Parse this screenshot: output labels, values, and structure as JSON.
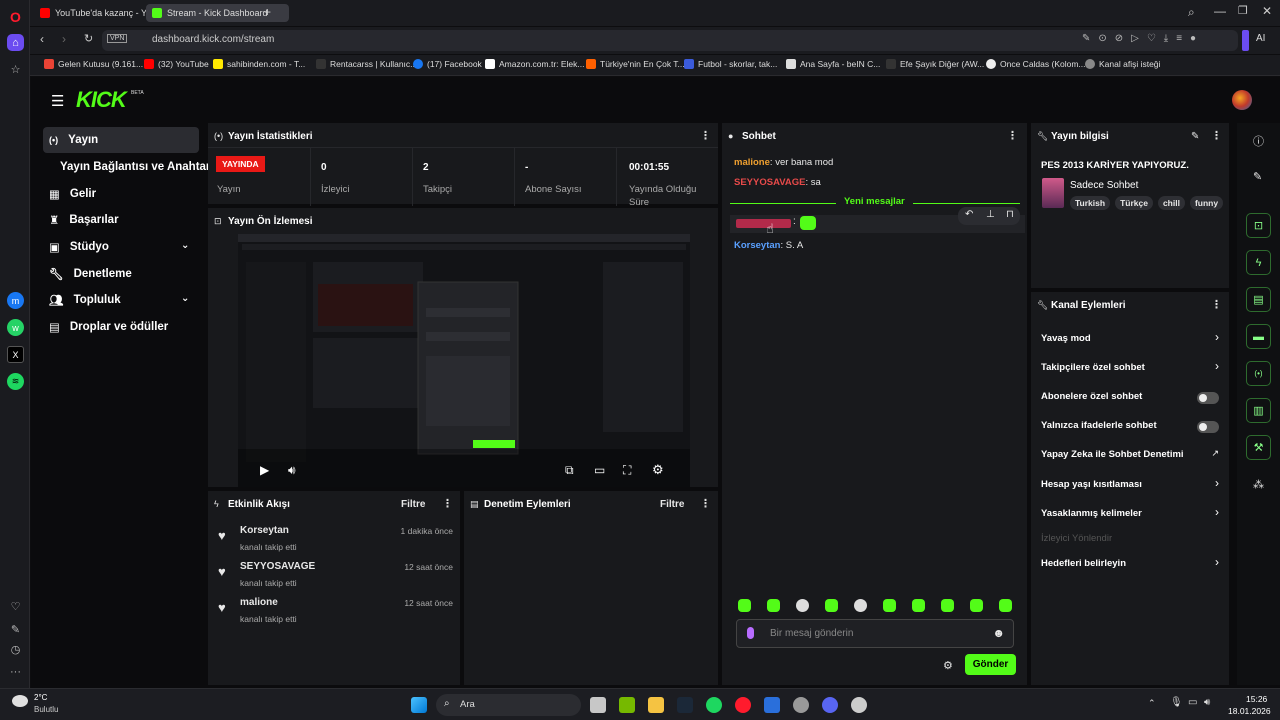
{
  "browser": {
    "tabs": [
      {
        "label": "YouTube'da kazanç - YouTu"
      },
      {
        "label": "Stream - Kick Dashboard"
      }
    ],
    "url": "dashboard.kick.com/stream",
    "vpn": "VPN",
    "ai": "AI",
    "bookmarks": [
      "Gelen Kutusu (9.161...",
      "(32) YouTube",
      "sahibinden.com - T...",
      "Rentacarss | Kullanıc...",
      "(17) Facebook",
      "Amazon.com.tr: Elek...",
      "Türkiye'nin En Çok T...",
      "Futbol - skorlar, tak...",
      "Ana Sayfa - beIN C...",
      "Efe Şayık Diğer (AW...",
      "Once Caldas (Kolom...",
      "Kanal afişi isteği"
    ]
  },
  "kick": {
    "logo": "KICK",
    "beta": "BETA"
  },
  "nav": {
    "items": [
      {
        "label": "Yayın"
      },
      {
        "label": "Yayın Bağlantısı ve Anahtarı"
      },
      {
        "label": "Gelir"
      },
      {
        "label": "Başarılar"
      },
      {
        "label": "Stüdyo"
      },
      {
        "label": "Denetleme"
      },
      {
        "label": "Topluluk"
      },
      {
        "label": "Droplar ve ödüller"
      }
    ]
  },
  "stats": {
    "title": "Yayın İstatistikleri",
    "live_badge": "YAYINDA",
    "live_label": "Yayın",
    "cells": [
      {
        "value": "0",
        "label": "İzleyici"
      },
      {
        "value": "2",
        "label": "Takipçi"
      },
      {
        "value": "-",
        "label": "Abone Sayısı"
      },
      {
        "value": "00:01:55",
        "label": "Yayında Olduğu Süre"
      }
    ]
  },
  "preview": {
    "title": "Yayın Ön İzlemesi"
  },
  "activity": {
    "title": "Etkinlik Akışı",
    "filter": "Filtre",
    "items": [
      {
        "name": "Korseytan",
        "text": "kanalı takip etti",
        "time": "1 dakika önce"
      },
      {
        "name": "SEYYOSAVAGE",
        "text": "kanalı takip etti",
        "time": "12 saat önce"
      },
      {
        "name": "malione",
        "text": "kanalı takip etti",
        "time": "12 saat önce"
      }
    ]
  },
  "moderation": {
    "title": "Denetim Eylemleri",
    "filter": "Filtre"
  },
  "chat": {
    "title": "Sohbet",
    "messages": [
      {
        "user": "malione",
        "text": "ver bana mod",
        "color": "#f0a030"
      },
      {
        "user": "SEYYOSAVAGE",
        "text": "sa",
        "color": "#e84a4a"
      }
    ],
    "new_messages": "Yeni mesajlar",
    "last_messages": [
      {
        "user": "Korseytan",
        "text": "S. A",
        "color": "#5aa0ff"
      }
    ],
    "placeholder": "Bir mesaj gönderin",
    "send": "Gönder"
  },
  "info": {
    "title": "Yayın bilgisi",
    "stream_title": "PES 2013 KARİYER YAPIYORUZ.",
    "category": "Sadece Sohbet",
    "tags": [
      "Turkish",
      "Türkçe",
      "chill",
      "funny"
    ]
  },
  "channel_actions": {
    "title": "Kanal Eylemleri",
    "rows": [
      {
        "label": "Yavaş mod",
        "kind": "chevron"
      },
      {
        "label": "Takipçilere özel sohbet",
        "kind": "chevron"
      },
      {
        "label": "Abonelere özel sohbet",
        "kind": "toggle"
      },
      {
        "label": "Yalnızca ifadelerle sohbet",
        "kind": "toggle"
      },
      {
        "label": "Yapay Zeka ile Sohbet Denetimi",
        "kind": "external"
      },
      {
        "label": "Hesap yaşı kısıtlaması",
        "kind": "chevron"
      },
      {
        "label": "Yasaklanmış kelimeler",
        "kind": "chevron"
      },
      {
        "label": "İzleyici Yönlendir",
        "kind": "disabled"
      },
      {
        "label": "Hedefleri belirleyin",
        "kind": "chevron"
      }
    ]
  },
  "taskbar": {
    "weather_temp": "2°C",
    "weather_desc": "Bulutlu",
    "search": "Ara",
    "time": "15:26",
    "date": "18.01.2026"
  },
  "colors": {
    "accent": "#53fc18",
    "live": "#e91916",
    "panel": "#18191c"
  }
}
